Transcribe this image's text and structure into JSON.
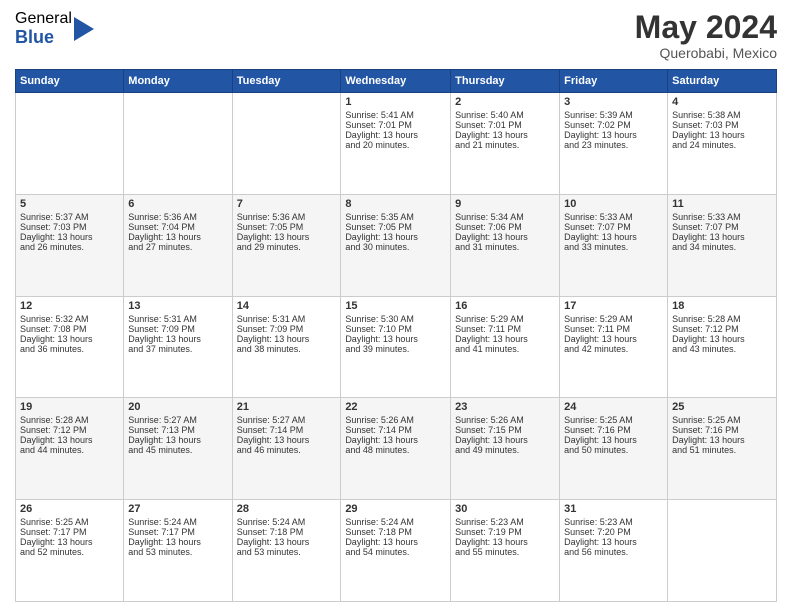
{
  "logo": {
    "general": "General",
    "blue": "Blue"
  },
  "title": {
    "month_year": "May 2024",
    "location": "Querobabi, Mexico"
  },
  "weekdays": [
    "Sunday",
    "Monday",
    "Tuesday",
    "Wednesday",
    "Thursday",
    "Friday",
    "Saturday"
  ],
  "weeks": [
    [
      {
        "day": "",
        "info": ""
      },
      {
        "day": "",
        "info": ""
      },
      {
        "day": "",
        "info": ""
      },
      {
        "day": "1",
        "info": "Sunrise: 5:41 AM\nSunset: 7:01 PM\nDaylight: 13 hours\nand 20 minutes."
      },
      {
        "day": "2",
        "info": "Sunrise: 5:40 AM\nSunset: 7:01 PM\nDaylight: 13 hours\nand 21 minutes."
      },
      {
        "day": "3",
        "info": "Sunrise: 5:39 AM\nSunset: 7:02 PM\nDaylight: 13 hours\nand 23 minutes."
      },
      {
        "day": "4",
        "info": "Sunrise: 5:38 AM\nSunset: 7:03 PM\nDaylight: 13 hours\nand 24 minutes."
      }
    ],
    [
      {
        "day": "5",
        "info": "Sunrise: 5:37 AM\nSunset: 7:03 PM\nDaylight: 13 hours\nand 26 minutes."
      },
      {
        "day": "6",
        "info": "Sunrise: 5:36 AM\nSunset: 7:04 PM\nDaylight: 13 hours\nand 27 minutes."
      },
      {
        "day": "7",
        "info": "Sunrise: 5:36 AM\nSunset: 7:05 PM\nDaylight: 13 hours\nand 29 minutes."
      },
      {
        "day": "8",
        "info": "Sunrise: 5:35 AM\nSunset: 7:05 PM\nDaylight: 13 hours\nand 30 minutes."
      },
      {
        "day": "9",
        "info": "Sunrise: 5:34 AM\nSunset: 7:06 PM\nDaylight: 13 hours\nand 31 minutes."
      },
      {
        "day": "10",
        "info": "Sunrise: 5:33 AM\nSunset: 7:07 PM\nDaylight: 13 hours\nand 33 minutes."
      },
      {
        "day": "11",
        "info": "Sunrise: 5:33 AM\nSunset: 7:07 PM\nDaylight: 13 hours\nand 34 minutes."
      }
    ],
    [
      {
        "day": "12",
        "info": "Sunrise: 5:32 AM\nSunset: 7:08 PM\nDaylight: 13 hours\nand 36 minutes."
      },
      {
        "day": "13",
        "info": "Sunrise: 5:31 AM\nSunset: 7:09 PM\nDaylight: 13 hours\nand 37 minutes."
      },
      {
        "day": "14",
        "info": "Sunrise: 5:31 AM\nSunset: 7:09 PM\nDaylight: 13 hours\nand 38 minutes."
      },
      {
        "day": "15",
        "info": "Sunrise: 5:30 AM\nSunset: 7:10 PM\nDaylight: 13 hours\nand 39 minutes."
      },
      {
        "day": "16",
        "info": "Sunrise: 5:29 AM\nSunset: 7:11 PM\nDaylight: 13 hours\nand 41 minutes."
      },
      {
        "day": "17",
        "info": "Sunrise: 5:29 AM\nSunset: 7:11 PM\nDaylight: 13 hours\nand 42 minutes."
      },
      {
        "day": "18",
        "info": "Sunrise: 5:28 AM\nSunset: 7:12 PM\nDaylight: 13 hours\nand 43 minutes."
      }
    ],
    [
      {
        "day": "19",
        "info": "Sunrise: 5:28 AM\nSunset: 7:12 PM\nDaylight: 13 hours\nand 44 minutes."
      },
      {
        "day": "20",
        "info": "Sunrise: 5:27 AM\nSunset: 7:13 PM\nDaylight: 13 hours\nand 45 minutes."
      },
      {
        "day": "21",
        "info": "Sunrise: 5:27 AM\nSunset: 7:14 PM\nDaylight: 13 hours\nand 46 minutes."
      },
      {
        "day": "22",
        "info": "Sunrise: 5:26 AM\nSunset: 7:14 PM\nDaylight: 13 hours\nand 48 minutes."
      },
      {
        "day": "23",
        "info": "Sunrise: 5:26 AM\nSunset: 7:15 PM\nDaylight: 13 hours\nand 49 minutes."
      },
      {
        "day": "24",
        "info": "Sunrise: 5:25 AM\nSunset: 7:16 PM\nDaylight: 13 hours\nand 50 minutes."
      },
      {
        "day": "25",
        "info": "Sunrise: 5:25 AM\nSunset: 7:16 PM\nDaylight: 13 hours\nand 51 minutes."
      }
    ],
    [
      {
        "day": "26",
        "info": "Sunrise: 5:25 AM\nSunset: 7:17 PM\nDaylight: 13 hours\nand 52 minutes."
      },
      {
        "day": "27",
        "info": "Sunrise: 5:24 AM\nSunset: 7:17 PM\nDaylight: 13 hours\nand 53 minutes."
      },
      {
        "day": "28",
        "info": "Sunrise: 5:24 AM\nSunset: 7:18 PM\nDaylight: 13 hours\nand 53 minutes."
      },
      {
        "day": "29",
        "info": "Sunrise: 5:24 AM\nSunset: 7:18 PM\nDaylight: 13 hours\nand 54 minutes."
      },
      {
        "day": "30",
        "info": "Sunrise: 5:23 AM\nSunset: 7:19 PM\nDaylight: 13 hours\nand 55 minutes."
      },
      {
        "day": "31",
        "info": "Sunrise: 5:23 AM\nSunset: 7:20 PM\nDaylight: 13 hours\nand 56 minutes."
      },
      {
        "day": "",
        "info": ""
      }
    ]
  ]
}
